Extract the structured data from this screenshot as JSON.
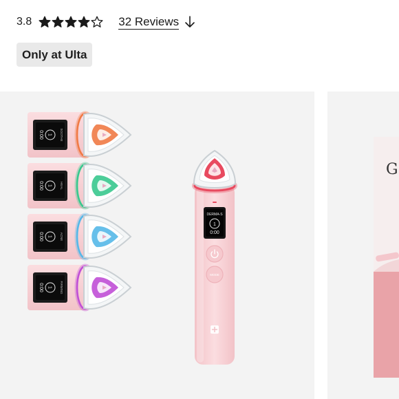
{
  "rating": {
    "value": "3.8",
    "stars": {
      "filled": 4,
      "total": 5
    },
    "star_color": "#1a1a1a"
  },
  "reviews": {
    "label": "32 Reviews",
    "icon": "arrow-down-icon"
  },
  "badge": {
    "label": "Only at Ulta",
    "background": "#e9e9e9"
  },
  "gallery": {
    "main_image": {
      "subject": "pink-facial-device-with-light-heads",
      "light_colors": [
        "#f07a45",
        "#38c88e",
        "#55b8e8",
        "#c04fd6"
      ],
      "device_color": "#f7cfd2",
      "main_tip_color": "#e84a5f",
      "device_screen": {
        "line1": "DERMA-S",
        "dial": "1",
        "time": "0:00"
      },
      "side_screens": [
        {
          "time": "0:00",
          "dial": "1",
          "label": "SOOTHE"
        },
        {
          "time": "0:00",
          "dial": "1",
          "label": "HEAL"
        },
        {
          "time": "0:00",
          "dial": "1",
          "label": "ACNE"
        },
        {
          "time": "0:00",
          "dial": "1",
          "label": "FIRMING"
        }
      ],
      "buttons": [
        "power-icon",
        "MODE"
      ]
    },
    "next_image": {
      "visible_letter": "G"
    }
  }
}
